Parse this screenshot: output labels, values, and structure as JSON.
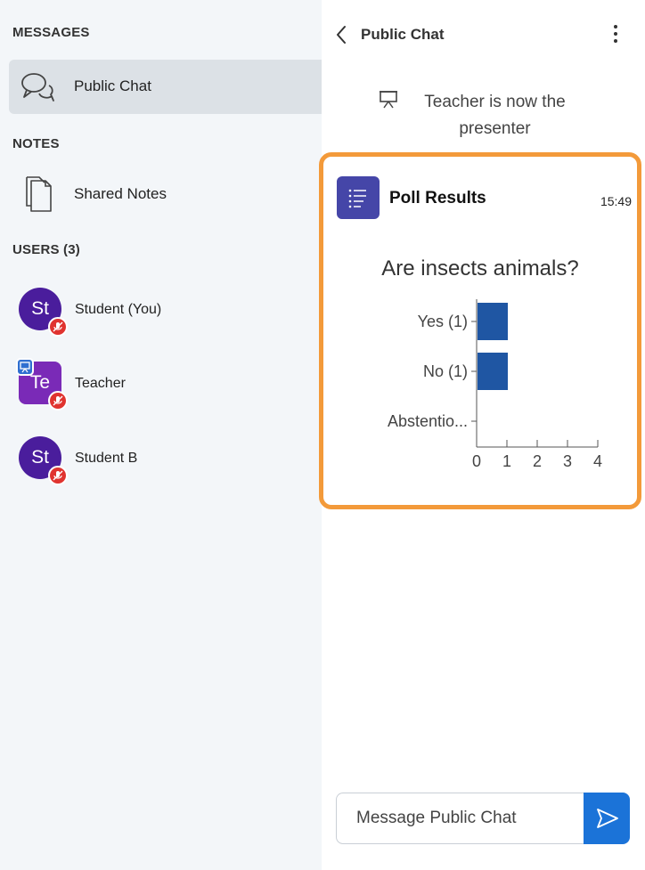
{
  "sidebar": {
    "messages_title": "MESSAGES",
    "public_chat_label": "Public Chat",
    "notes_title": "NOTES",
    "shared_notes_label": "Shared Notes",
    "users_title": "USERS (3)",
    "users": [
      {
        "initials": "St",
        "name": "Student (You)"
      },
      {
        "initials": "Te",
        "name": "Teacher"
      },
      {
        "initials": "St",
        "name": "Student B"
      }
    ]
  },
  "panel": {
    "title": "Public Chat",
    "presenter_note": "Teacher is now the presenter",
    "poll": {
      "title": "Poll Results",
      "time": "15:49",
      "question": "Are insects animals?"
    },
    "input_placeholder": "Message Public Chat"
  },
  "colors": {
    "accent": "#1b73d8",
    "poll_border": "#f39a3a",
    "bar": "#1f56a3",
    "avatar": "#4a1d9c",
    "avatar_teacher": "#7a2ab7",
    "mute": "#e0332f"
  },
  "chart_data": {
    "type": "bar",
    "orientation": "horizontal",
    "categories": [
      "Yes (1)",
      "No (1)",
      "Abstentio..."
    ],
    "values": [
      1,
      1,
      0
    ],
    "xticks": [
      "0",
      "1",
      "2",
      "3",
      "4"
    ],
    "xlim": [
      0,
      4
    ],
    "grid": false
  }
}
